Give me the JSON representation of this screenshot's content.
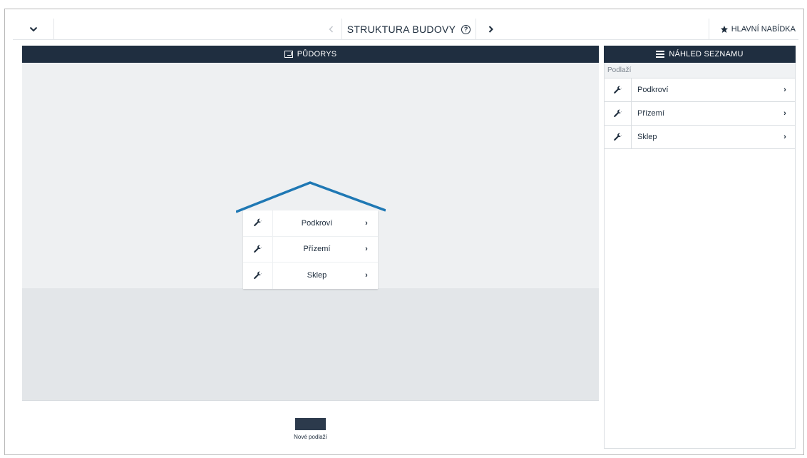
{
  "topbar": {
    "collapse_icon": "chevron-down-icon",
    "prev_icon": "chevron-left-icon",
    "title": "STRUKTURA BUDOVY",
    "help_icon": "help-circle-icon",
    "help_glyph": "?",
    "next_icon": "chevron-right-icon",
    "main_menu_icon": "star-icon",
    "main_menu_label": "HLAVNÍ NABÍDKA"
  },
  "plan_panel": {
    "header_icon": "floorplan-icon",
    "header_title": "PŮDORYS",
    "roof_color": "#1f78b4",
    "floors": [
      {
        "label": "Podkroví",
        "icon": "wrench-icon"
      },
      {
        "label": "Přízemí",
        "icon": "wrench-icon"
      },
      {
        "label": "Sklep",
        "icon": "wrench-icon"
      }
    ],
    "new_floor_label": "Nové podlaží"
  },
  "list_panel": {
    "header_icon": "list-icon",
    "header_title": "NÁHLED SEZNAMU",
    "subheader": "Podlaží",
    "items": [
      {
        "label": "Podkroví",
        "icon": "wrench-icon"
      },
      {
        "label": "Přízemí",
        "icon": "wrench-icon"
      },
      {
        "label": "Sklep",
        "icon": "wrench-icon"
      }
    ]
  },
  "colors": {
    "header_bg": "#1f2e40",
    "accent": "#1f78b4",
    "text": "#1e2d3d"
  }
}
